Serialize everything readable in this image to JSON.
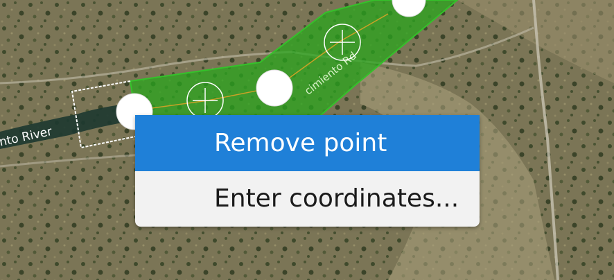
{
  "map": {
    "labels": {
      "river": "nto River",
      "street": "cimiento Rd"
    },
    "colors": {
      "terrain": "#6f6a4e",
      "polygon_fill": "#2aa61e",
      "polygon_stroke": "#34c22a",
      "vertex_fill": "#ffffff"
    }
  },
  "context_menu": {
    "items": [
      {
        "label": "Remove point",
        "highlighted": true
      },
      {
        "label": "Enter coordinates..."
      }
    ],
    "colors": {
      "highlight": "#1f80d8",
      "background": "#f2f2f2"
    }
  }
}
